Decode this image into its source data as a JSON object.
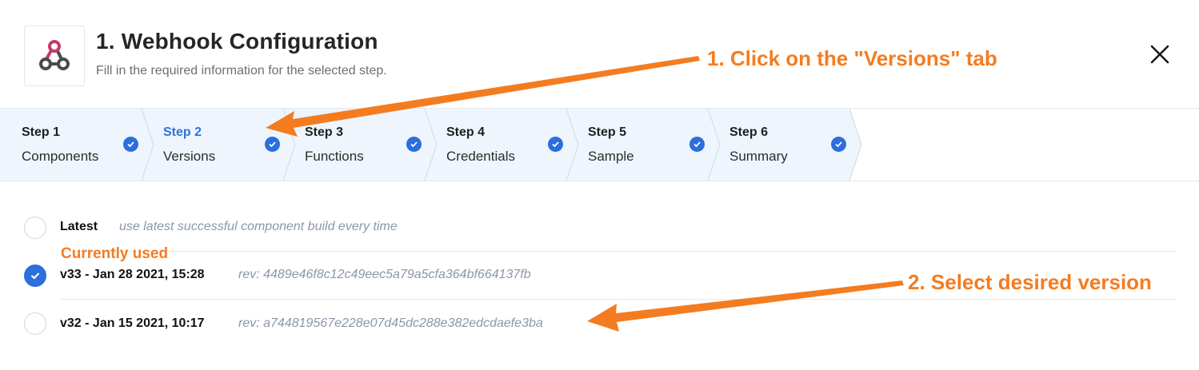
{
  "header": {
    "title": "1. Webhook Configuration",
    "subtitle": "Fill in the required information for the selected step."
  },
  "steps": [
    {
      "num": "Step 1",
      "label": "Components",
      "done": true,
      "active": false
    },
    {
      "num": "Step 2",
      "label": "Versions",
      "done": true,
      "active": true
    },
    {
      "num": "Step 3",
      "label": "Functions",
      "done": true,
      "active": false
    },
    {
      "num": "Step 4",
      "label": "Credentials",
      "done": true,
      "active": false
    },
    {
      "num": "Step 5",
      "label": "Sample",
      "done": true,
      "active": false
    },
    {
      "num": "Step 6",
      "label": "Summary",
      "done": true,
      "active": false
    }
  ],
  "versions": [
    {
      "name": "Latest",
      "detail": "use latest successful component build every time",
      "selected": false
    },
    {
      "name": "v33 - Jan 28 2021, 15:28",
      "detail": "rev: 4489e46f8c12c49eec5a79a5cfa364bf664137fb",
      "selected": true
    },
    {
      "name": "v32 - Jan 15 2021, 10:17",
      "detail": "rev: a744819567e228e07d45dc288e382edcdaefe3ba",
      "selected": false
    }
  ],
  "annotations": {
    "click_tab": "1. Click on the \"Versions\" tab",
    "currently_used": "Currently used",
    "select_version": "2. Select desired version"
  },
  "colors": {
    "accent": "#2a6fdb",
    "annotation": "#f47c20",
    "step_bg": "#eef5fd"
  },
  "icons": {
    "logo": "webhook-icon",
    "close": "close-icon",
    "check": "check-icon"
  }
}
